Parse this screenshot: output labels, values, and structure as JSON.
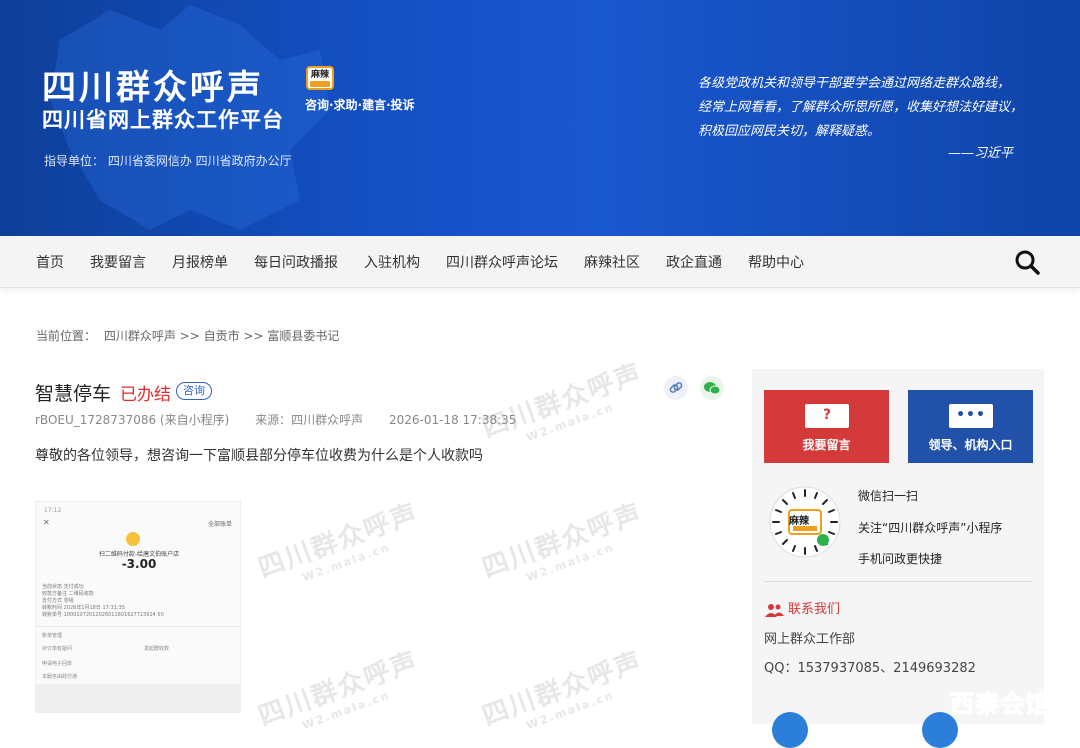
{
  "banner": {
    "title": "四川群众呼声",
    "subtitle": "四川省网上群众工作平台",
    "logo_text": "麻辣",
    "tagline": "咨询·求助·建言·投诉",
    "guide": "指导单位：  四川省委网信办  四川省政府办公厅",
    "quote_lines": [
      "各级党政机关和领导干部要学会通过网络走群众路线，",
      "经常上网看看，了解群众所思所愿，收集好想法好建议，",
      "积极回应网民关切，解释疑惑。"
    ],
    "quote_author": "——习近平"
  },
  "nav": {
    "items": [
      "首页",
      "我要留言",
      "月报榜单",
      "每日问政播报",
      "入驻机构",
      "四川群众呼声论坛",
      "麻辣社区",
      "政企直通",
      "帮助中心"
    ]
  },
  "breadcrumb": {
    "label": "当前位置：",
    "path": "四川群众呼声 >> 自贡市 >> 富顺县委书记"
  },
  "post": {
    "title": "智慧停车",
    "status": "已办结",
    "type": "咨询",
    "id": "rBOEU_1728737086 (来自小程序)",
    "source": "来源：四川群众呼声",
    "time": "2026-01-18 17:38:35",
    "body": "尊敬的各位领导，想咨询一下富顺县部分停车位收费为什么是个人收款吗"
  },
  "receipt": {
    "time": "17:12",
    "all_bills": "全部账单",
    "merchant": "扫二维码付款-给唐文伯账户店",
    "amount": "-3.00",
    "rows": [
      "当前状态    支付成功",
      "收款方备注  二维码收款",
      "支付方式    零钱",
      "转账时间    2026年1月18日 17:31:35",
      "转账单号    10001072012026011801627723924 50"
    ],
    "foot": [
      "账单管理",
      "对订单有疑问",
      "发起群收款",
      "申请电子回单",
      "本服务由财付通"
    ]
  },
  "watermark": {
    "text": "四川群众呼声",
    "url": "W2.mala.cn"
  },
  "sidebar": {
    "message_button": "我要留言",
    "message_icon": "?",
    "leader_button": "领导、机构入口",
    "leader_icon": "•••",
    "qr_logo": "麻辣",
    "qr_lines": [
      "微信扫一扫",
      "关注“四川群众呼声”小程序",
      "手机问政更快捷"
    ],
    "contact_title": "联系我们",
    "contact_dept": "网上群众工作部",
    "contact_qq": "QQ：1537937085、2149693282"
  },
  "stamp": "西秦会馆",
  "colors": {
    "banner_blue": "#1450c4",
    "status_red": "#e02d2d",
    "message_red": "#d43a3a",
    "leader_blue": "#2151a8"
  }
}
